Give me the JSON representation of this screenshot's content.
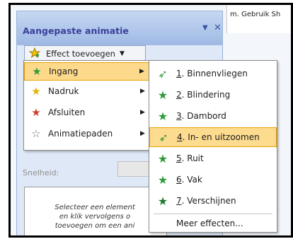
{
  "document": {
    "text": "m. Gebruik Sh"
  },
  "pane": {
    "title": "Aangepaste animatie",
    "dropdown_icon": "▼",
    "close_icon": "✕",
    "effect_button": {
      "label": "Effect toevoegen",
      "icon": "star-icon",
      "dropdown": "▼"
    },
    "speed_label": "Snelheid:",
    "instructions": [
      "Selecteer een element",
      "en klik vervolgens o",
      "toevoegen om een ani"
    ]
  },
  "submenu1": {
    "items": [
      {
        "label": "Ingang",
        "icon": "green-star-icon",
        "color": "#2e9b3a",
        "active": true
      },
      {
        "label": "Nadruk",
        "icon": "yellow-star-icon",
        "color": "#e2b300",
        "active": false
      },
      {
        "label": "Afsluiten",
        "icon": "red-star-icon",
        "color": "#d03a2a",
        "active": false
      },
      {
        "label": "Animatiepaden",
        "icon": "outline-star-icon",
        "color": "#777777",
        "active": false
      }
    ],
    "arrow": "▶"
  },
  "submenu2": {
    "items": [
      {
        "num": "1",
        "label": "Binnenvliegen",
        "icon": "fly-in-icon",
        "active": false
      },
      {
        "num": "2",
        "label": "Blindering",
        "icon": "blinds-icon",
        "active": false
      },
      {
        "num": "3",
        "label": "Dambord",
        "icon": "checkerboard-icon",
        "active": false
      },
      {
        "num": "4",
        "label": "In- en uitzoomen",
        "icon": "zoom-icon",
        "active": true
      },
      {
        "num": "5",
        "label": "Ruit",
        "icon": "diamond-icon",
        "active": false
      },
      {
        "num": "6",
        "label": "Vak",
        "icon": "box-icon",
        "active": false
      },
      {
        "num": "7",
        "label": "Verschijnen",
        "icon": "appear-icon",
        "active": false
      }
    ],
    "more": "Meer effecten..."
  }
}
